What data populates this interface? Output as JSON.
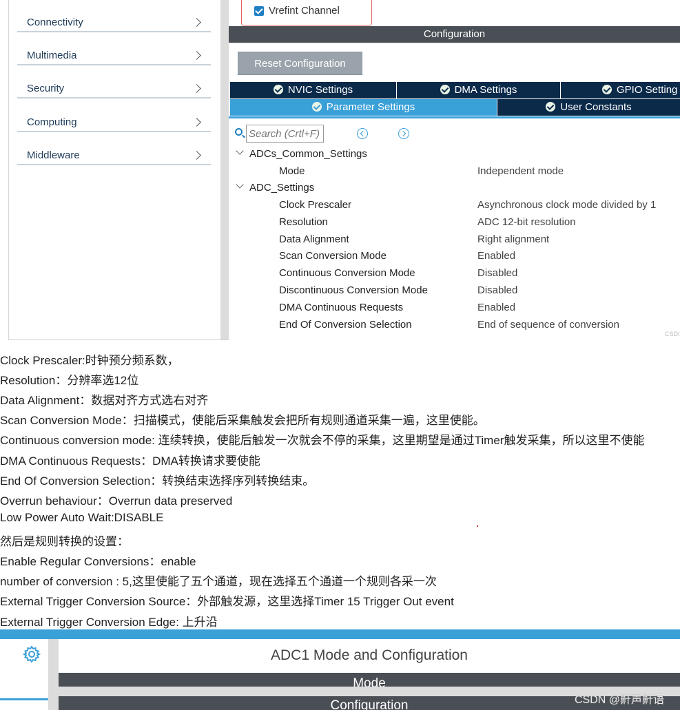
{
  "sidebar": {
    "categories": [
      "Connectivity",
      "Multimedia",
      "Security",
      "Computing",
      "Middleware"
    ]
  },
  "checkbox": {
    "label": "Vrefint Channel",
    "checked": true
  },
  "config_header": "Configuration",
  "reset_button": "Reset Configuration",
  "tabs": {
    "nvic": "NVIC Settings",
    "dma": "DMA Settings",
    "gpio": "GPIO Setting",
    "parameter": "Parameter Settings",
    "user": "User Constants"
  },
  "search": {
    "placeholder": "Search (Crtl+F)"
  },
  "groups": {
    "common": "ADCs_Common_Settings",
    "adc": "ADC_Settings"
  },
  "params": [
    {
      "name": "Mode",
      "value": "Independent mode"
    },
    {
      "name": "Clock Prescaler",
      "value": "Asynchronous clock mode divided by 1"
    },
    {
      "name": "Resolution",
      "value": "ADC 12-bit resolution"
    },
    {
      "name": "Data Alignment",
      "value": "Right alignment"
    },
    {
      "name": "Scan Conversion Mode",
      "value": "Enabled"
    },
    {
      "name": "Continuous Conversion Mode",
      "value": "Disabled"
    },
    {
      "name": "Discontinuous Conversion Mode",
      "value": "Disabled"
    },
    {
      "name": "DMA Continuous Requests",
      "value": "Enabled"
    },
    {
      "name": "End Of Conversion Selection",
      "value": "End of sequence of conversion"
    }
  ],
  "small_watermark": "CSDI",
  "notes": [
    "Clock Prescaler:时钟预分频系数，",
    "Resolution：分辨率选12位",
    "Data Alignment：数据对齐方式选右对齐",
    "Scan Conversion Mode：扫描模式，使能后采集触发会把所有规则通道采集一遍，这里使能。",
    "Continuous conversion mode: 连续转换，使能后触发一次就会不停的采集，这里期望是通过Timer触发采集，所以这里不使能",
    "DMA Continuous Requests：DMA转换请求要使能",
    "End Of Conversion Selection：转换结束选择序列转换结束。",
    "Overrun behaviour：Overrun data preserved",
    "Low Power Auto Wait:DISABLE",
    "然后是规则转换的设置：",
    "Enable Regular Conversions：enable",
    "number of conversion : 5,这里使能了五个通道，现在选择五个通道一个规则各采一次",
    "External Trigger Conversion Source：外部触发源，这里选择Timer 15 Trigger Out event",
    "External Trigger Conversion Edge: 上升沿"
  ],
  "bottom": {
    "title": "ADC1 Mode and Configuration",
    "mode_header": "Mode",
    "config_header": "Configuration",
    "watermark": "CSDN @鼾声鼾语"
  },
  "colors": {
    "dark_tab": "#0b2a4a",
    "active_tab": "#3aa0d8",
    "header_bar": "#4a4f55",
    "button": "#9aa3ab"
  }
}
